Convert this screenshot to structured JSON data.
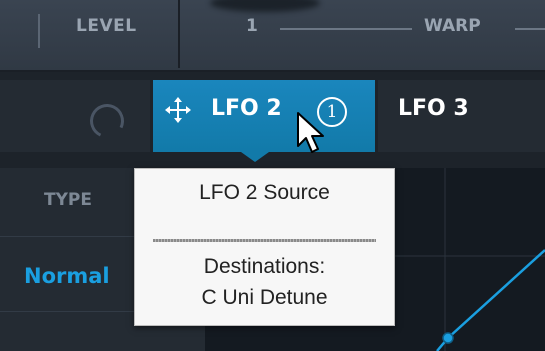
{
  "top": {
    "level_label": "LEVEL",
    "warp_value": "1",
    "warp_label": "WARP"
  },
  "tabs": [
    {
      "label": "",
      "icon": "refresh-icon",
      "active": false
    },
    {
      "label": "LFO 2",
      "icon": "move-icon",
      "badge": "1",
      "active": true
    },
    {
      "label": "LFO 3",
      "active": false
    }
  ],
  "panel": {
    "type_label": "TYPE",
    "type_value": "Normal"
  },
  "tooltip": {
    "title": "LFO 2 Source",
    "destinations_heading": "Destinations:",
    "destinations": [
      "C Uni Detune"
    ]
  },
  "colors": {
    "accent": "#1a86bd",
    "accent_text": "#1a9fe0",
    "background": "#20262e"
  }
}
